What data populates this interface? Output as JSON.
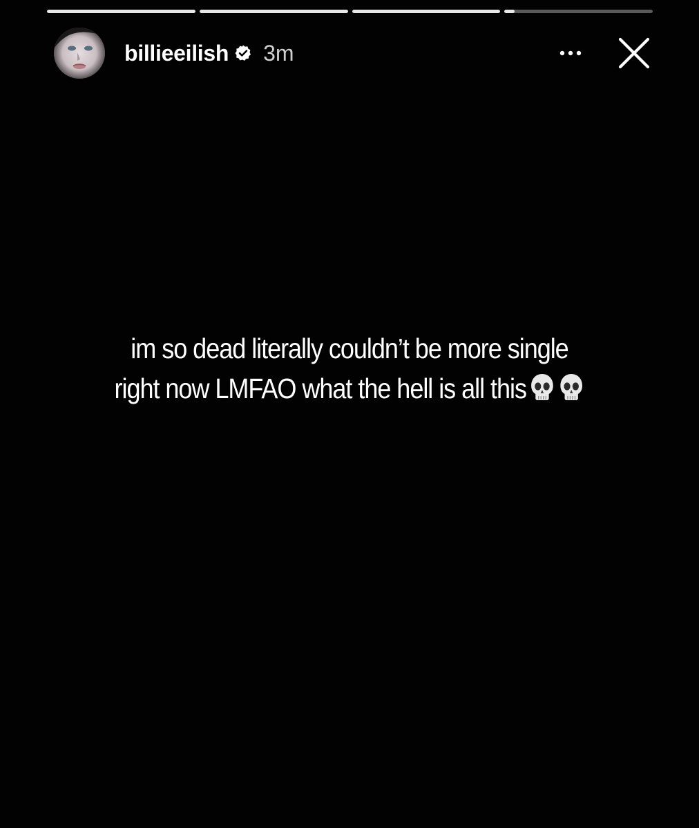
{
  "story": {
    "progress": [
      1,
      1,
      1,
      0.07
    ],
    "account": {
      "username": "billieeilish",
      "verified": true,
      "time_ago": "3m",
      "avatar_icon": "profile-avatar"
    },
    "actions": {
      "more_icon": "more-horizontal-icon",
      "close_icon": "close-icon"
    },
    "caption": {
      "line1": "im so dead literally couldn’t be more single",
      "line2": "right now LMFAO what the hell is all this",
      "emoji_icons": [
        "skull-icon",
        "skull-icon"
      ]
    },
    "colors": {
      "background": "#020202",
      "text": "#ffffff",
      "progress_track": "rgba(255,255,255,0.35)",
      "progress_fill": "#e8e8e8"
    }
  }
}
